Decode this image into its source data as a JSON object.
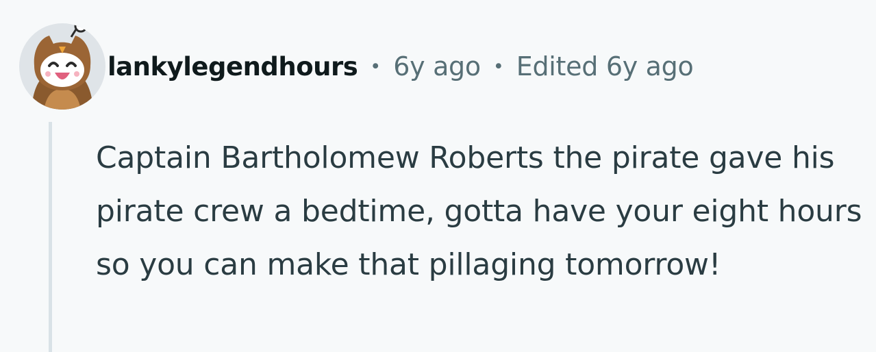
{
  "comment": {
    "avatar_icon": "owl-snoo-avatar-icon",
    "author": "lankylegendhours",
    "separator": "•",
    "posted": "6y ago",
    "edited": "Edited 6y ago",
    "body": "Captain Bartholomew Roberts the pirate gave his pirate crew a bedtime, gotta have your eight hours so you can make that pillaging tomorrow!"
  },
  "colors": {
    "background": "#f7f9fa",
    "username": "#0f1a1c",
    "meta": "#576f76",
    "body_text": "#2a3c42",
    "thread_line": "#d9e2e7"
  }
}
